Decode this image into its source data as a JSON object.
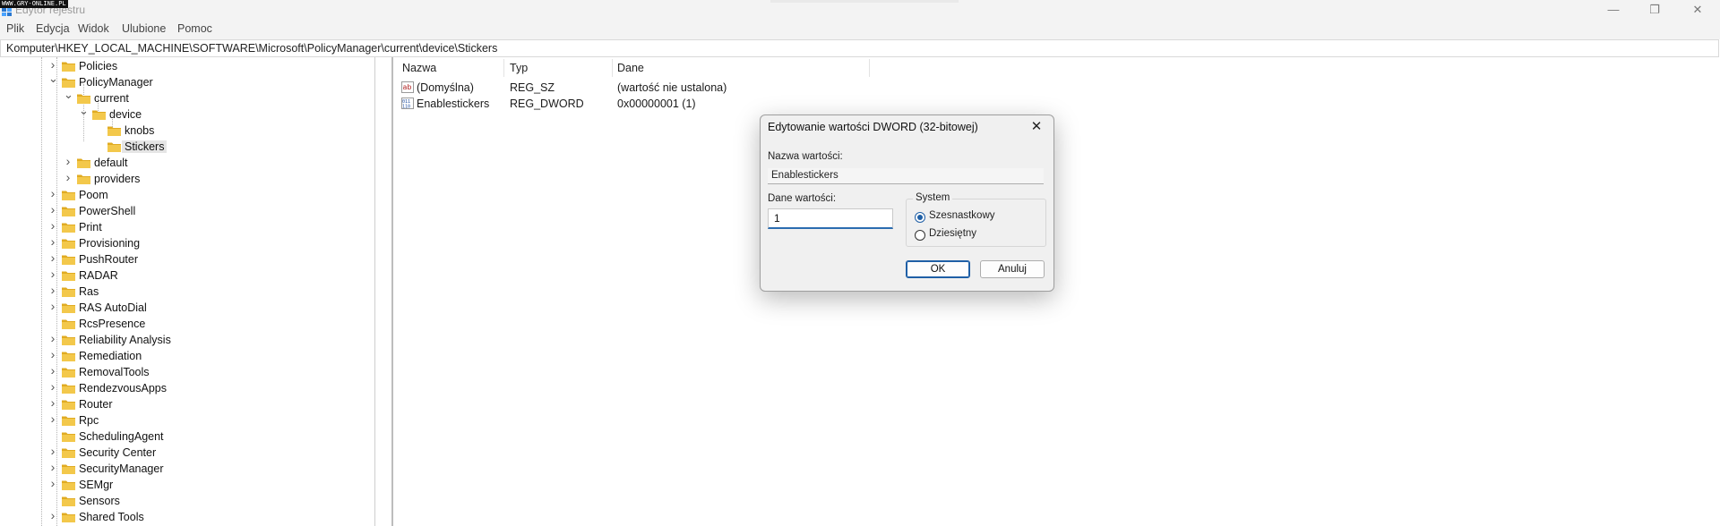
{
  "watermark": "WWW.GRY-ONLINE.PL",
  "window": {
    "title": "Edytor rejestru",
    "minimize_glyph": "—",
    "maximize_glyph": "❐",
    "close_glyph": "✕"
  },
  "menu": [
    "Plik",
    "Edycja",
    "Widok",
    "Ulubione",
    "Pomoc"
  ],
  "address": "Komputer\\HKEY_LOCAL_MACHINE\\SOFTWARE\\Microsoft\\PolicyManager\\current\\device\\Stickers",
  "tree": [
    {
      "label": "Policies",
      "expander": "›"
    },
    {
      "label": "PolicyManager",
      "expander": "⌄"
    },
    {
      "label": "current",
      "expander": "⌄"
    },
    {
      "label": "device",
      "expander": "⌄"
    },
    {
      "label": "knobs",
      "expander": ""
    },
    {
      "label": "Stickers",
      "expander": "",
      "selected": true
    },
    {
      "label": "default",
      "expander": "›"
    },
    {
      "label": "providers",
      "expander": "›"
    },
    {
      "label": "Poom",
      "expander": "›"
    },
    {
      "label": "PowerShell",
      "expander": "›"
    },
    {
      "label": "Print",
      "expander": "›"
    },
    {
      "label": "Provisioning",
      "expander": "›"
    },
    {
      "label": "PushRouter",
      "expander": "›"
    },
    {
      "label": "RADAR",
      "expander": "›"
    },
    {
      "label": "Ras",
      "expander": "›"
    },
    {
      "label": "RAS AutoDial",
      "expander": "›"
    },
    {
      "label": "RcsPresence",
      "expander": ""
    },
    {
      "label": "Reliability Analysis",
      "expander": "›"
    },
    {
      "label": "Remediation",
      "expander": "›"
    },
    {
      "label": "RemovalTools",
      "expander": "›"
    },
    {
      "label": "RendezvousApps",
      "expander": "›"
    },
    {
      "label": "Router",
      "expander": "›"
    },
    {
      "label": "Rpc",
      "expander": "›"
    },
    {
      "label": "SchedulingAgent",
      "expander": ""
    },
    {
      "label": "Security Center",
      "expander": "›"
    },
    {
      "label": "SecurityManager",
      "expander": "›"
    },
    {
      "label": "SEMgr",
      "expander": "›"
    },
    {
      "label": "Sensors",
      "expander": ""
    },
    {
      "label": "Shared Tools",
      "expander": "›"
    }
  ],
  "list": {
    "columns": {
      "name": "Nazwa",
      "type": "Typ",
      "data": "Dane"
    },
    "rows": [
      {
        "name": "(Domyślna)",
        "type": "REG_SZ",
        "data": "(wartość nie ustalona)",
        "icon": "string-value-icon"
      },
      {
        "name": "Enablestickers",
        "type": "REG_DWORD",
        "data": "0x00000001 (1)",
        "icon": "binary-value-icon"
      }
    ]
  },
  "dialog": {
    "title": "Edytowanie wartości DWORD (32-bitowej)",
    "close_glyph": "✕",
    "name_label": "Nazwa wartości:",
    "name_value": "Enablestickers",
    "data_label": "Dane wartości:",
    "data_value": "1",
    "base_label": "System",
    "base_options": [
      {
        "label": "Szesnastkowy",
        "selected": true
      },
      {
        "label": "Dziesiętny",
        "selected": false
      }
    ],
    "ok_label": "OK",
    "cancel_label": "Anuluj"
  },
  "colors": {
    "folder": "#f3c84b",
    "folder_dark": "#e0ab22",
    "accent": "#1f5fa6",
    "selection": "#e5e5e5"
  }
}
